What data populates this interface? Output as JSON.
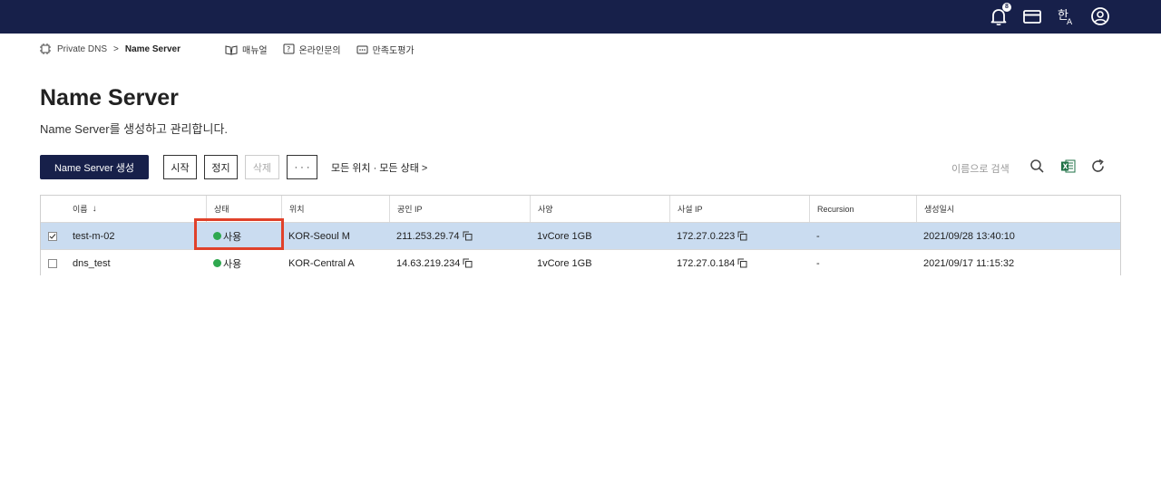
{
  "colors": {
    "topbar": "#17204a",
    "selected_row": "#cadcf0",
    "status_active": "#2fa84f",
    "highlight": "#e0412a"
  },
  "topbar": {
    "icons": [
      "bell-icon",
      "card-icon",
      "language-icon",
      "user-icon"
    ],
    "notification_count": "8"
  },
  "breadcrumb": {
    "service": "Private DNS",
    "separator": ">",
    "current": "Name Server"
  },
  "help_links": [
    "매뉴얼",
    "온라인문의",
    "만족도평가"
  ],
  "page": {
    "title": "Name Server",
    "description": "Name Server를 생성하고 관리합니다."
  },
  "toolbar": {
    "create_label": "Name Server 생성",
    "start_label": "시작",
    "stop_label": "정지",
    "delete_label": "삭제",
    "more_label": "· · ·",
    "filter_label": "모든 위치 · 모든 상태 >",
    "search_placeholder": "이름으로 검색"
  },
  "table": {
    "columns": [
      "이름",
      "상태",
      "위치",
      "공인 IP",
      "사양",
      "사설 IP",
      "Recursion",
      "생성일시"
    ],
    "sort_indicator": "↓",
    "rows": [
      {
        "selected": true,
        "name": "test-m-02",
        "status": "사용",
        "location": "KOR-Seoul M",
        "public_ip": "211.253.29.74",
        "spec": "1vCore 1GB",
        "private_ip": "172.27.0.223",
        "recursion": "-",
        "created": "2021/09/28 13:40:10"
      },
      {
        "selected": false,
        "name": "dns_test",
        "status": "사용",
        "location": "KOR-Central A",
        "public_ip": "14.63.219.234",
        "spec": "1vCore 1GB",
        "private_ip": "172.27.0.184",
        "recursion": "-",
        "created": "2021/09/17 11:15:32"
      }
    ]
  }
}
